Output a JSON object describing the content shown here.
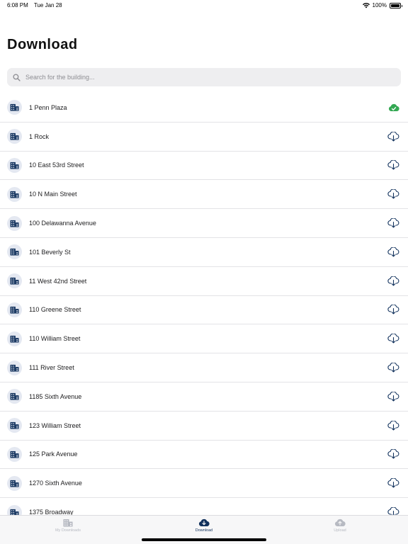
{
  "status_bar": {
    "time": "6:08 PM",
    "date": "Tue Jan 28",
    "battery": "100%",
    "icons": [
      "wifi-icon",
      "battery-icon"
    ]
  },
  "page": {
    "title": "Download"
  },
  "search": {
    "placeholder": "Search for the building...",
    "value": "",
    "icon": "search-icon"
  },
  "buildings": [
    {
      "name": "1 Penn Plaza",
      "status": "downloaded"
    },
    {
      "name": "1 Rock",
      "status": "available"
    },
    {
      "name": "10 East 53rd Street",
      "status": "available"
    },
    {
      "name": "10 N Main Street",
      "status": "available"
    },
    {
      "name": "100 Delawanna Avenue",
      "status": "available"
    },
    {
      "name": "101 Beverly St",
      "status": "available"
    },
    {
      "name": "11 West 42nd Street",
      "status": "available"
    },
    {
      "name": "110 Greene Street",
      "status": "available"
    },
    {
      "name": "110 William Street",
      "status": "available"
    },
    {
      "name": "111 River Street",
      "status": "available"
    },
    {
      "name": "1185 Sixth Avenue",
      "status": "available"
    },
    {
      "name": "123 William Street",
      "status": "available"
    },
    {
      "name": "125 Park Avenue",
      "status": "available"
    },
    {
      "name": "1270 Sixth Avenue",
      "status": "available"
    },
    {
      "name": "1375 Broadway",
      "status": "available"
    }
  ],
  "tab_bar": {
    "tabs": [
      {
        "label": "My Downloads",
        "icon": "building-icon",
        "active": false
      },
      {
        "label": "Download",
        "icon": "cloud-download-icon",
        "active": true
      },
      {
        "label": "Upload",
        "icon": "cloud-upload-icon",
        "active": false
      }
    ]
  },
  "colors": {
    "accent": "#12325d",
    "downloaded": "#34a853",
    "inactive": "#b7bac2",
    "badge_bg": "#e4e8f1"
  }
}
